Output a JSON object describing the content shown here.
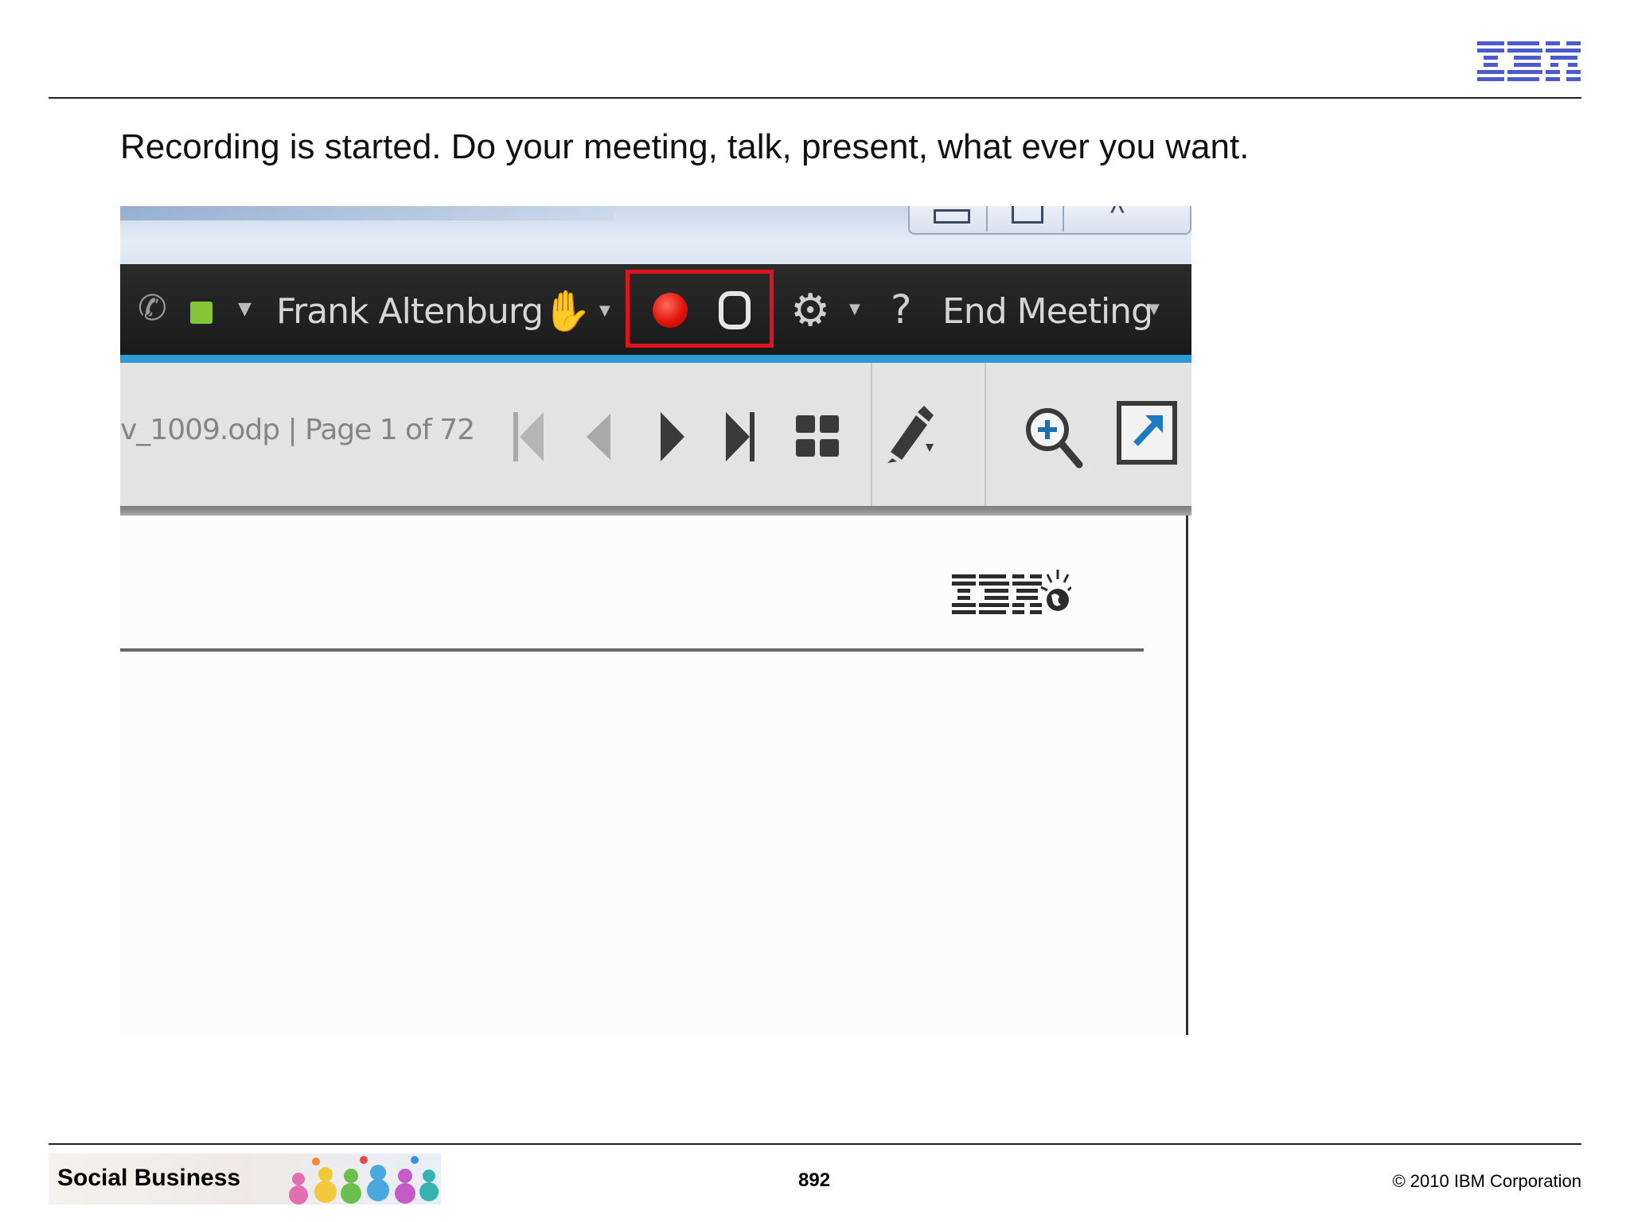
{
  "slide": {
    "headline": "Recording is started. Do your meeting, talk, present, what ever you want.",
    "logo": "ibm-logo"
  },
  "toolbar": {
    "user_name": "Frank Altenburg",
    "end_meeting_label": "End Meeting",
    "help_label": "?",
    "record_accent": "#e0141c",
    "status_color": "#86c43a"
  },
  "navigation": {
    "page_info": "v_1009.odp | Page 1 of 72",
    "accent_color": "#2e9ad4"
  },
  "footer": {
    "label": "Social Business",
    "page_number": "892",
    "copyright": "© 2010 IBM Corporation"
  }
}
